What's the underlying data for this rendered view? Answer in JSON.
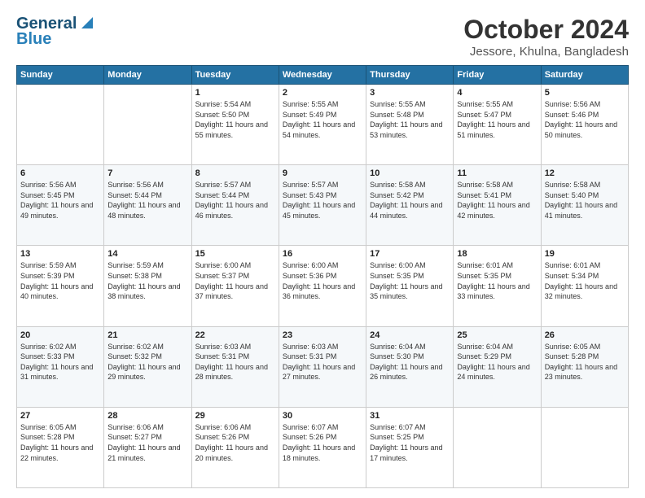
{
  "header": {
    "logo_line1": "General",
    "logo_line2": "Blue",
    "title": "October 2024",
    "subtitle": "Jessore, Khulna, Bangladesh"
  },
  "weekdays": [
    "Sunday",
    "Monday",
    "Tuesday",
    "Wednesday",
    "Thursday",
    "Friday",
    "Saturday"
  ],
  "weeks": [
    [
      {
        "day": "",
        "info": ""
      },
      {
        "day": "",
        "info": ""
      },
      {
        "day": "1",
        "info": "Sunrise: 5:54 AM\nSunset: 5:50 PM\nDaylight: 11 hours and 55 minutes."
      },
      {
        "day": "2",
        "info": "Sunrise: 5:55 AM\nSunset: 5:49 PM\nDaylight: 11 hours and 54 minutes."
      },
      {
        "day": "3",
        "info": "Sunrise: 5:55 AM\nSunset: 5:48 PM\nDaylight: 11 hours and 53 minutes."
      },
      {
        "day": "4",
        "info": "Sunrise: 5:55 AM\nSunset: 5:47 PM\nDaylight: 11 hours and 51 minutes."
      },
      {
        "day": "5",
        "info": "Sunrise: 5:56 AM\nSunset: 5:46 PM\nDaylight: 11 hours and 50 minutes."
      }
    ],
    [
      {
        "day": "6",
        "info": "Sunrise: 5:56 AM\nSunset: 5:45 PM\nDaylight: 11 hours and 49 minutes."
      },
      {
        "day": "7",
        "info": "Sunrise: 5:56 AM\nSunset: 5:44 PM\nDaylight: 11 hours and 48 minutes."
      },
      {
        "day": "8",
        "info": "Sunrise: 5:57 AM\nSunset: 5:44 PM\nDaylight: 11 hours and 46 minutes."
      },
      {
        "day": "9",
        "info": "Sunrise: 5:57 AM\nSunset: 5:43 PM\nDaylight: 11 hours and 45 minutes."
      },
      {
        "day": "10",
        "info": "Sunrise: 5:58 AM\nSunset: 5:42 PM\nDaylight: 11 hours and 44 minutes."
      },
      {
        "day": "11",
        "info": "Sunrise: 5:58 AM\nSunset: 5:41 PM\nDaylight: 11 hours and 42 minutes."
      },
      {
        "day": "12",
        "info": "Sunrise: 5:58 AM\nSunset: 5:40 PM\nDaylight: 11 hours and 41 minutes."
      }
    ],
    [
      {
        "day": "13",
        "info": "Sunrise: 5:59 AM\nSunset: 5:39 PM\nDaylight: 11 hours and 40 minutes."
      },
      {
        "day": "14",
        "info": "Sunrise: 5:59 AM\nSunset: 5:38 PM\nDaylight: 11 hours and 38 minutes."
      },
      {
        "day": "15",
        "info": "Sunrise: 6:00 AM\nSunset: 5:37 PM\nDaylight: 11 hours and 37 minutes."
      },
      {
        "day": "16",
        "info": "Sunrise: 6:00 AM\nSunset: 5:36 PM\nDaylight: 11 hours and 36 minutes."
      },
      {
        "day": "17",
        "info": "Sunrise: 6:00 AM\nSunset: 5:35 PM\nDaylight: 11 hours and 35 minutes."
      },
      {
        "day": "18",
        "info": "Sunrise: 6:01 AM\nSunset: 5:35 PM\nDaylight: 11 hours and 33 minutes."
      },
      {
        "day": "19",
        "info": "Sunrise: 6:01 AM\nSunset: 5:34 PM\nDaylight: 11 hours and 32 minutes."
      }
    ],
    [
      {
        "day": "20",
        "info": "Sunrise: 6:02 AM\nSunset: 5:33 PM\nDaylight: 11 hours and 31 minutes."
      },
      {
        "day": "21",
        "info": "Sunrise: 6:02 AM\nSunset: 5:32 PM\nDaylight: 11 hours and 29 minutes."
      },
      {
        "day": "22",
        "info": "Sunrise: 6:03 AM\nSunset: 5:31 PM\nDaylight: 11 hours and 28 minutes."
      },
      {
        "day": "23",
        "info": "Sunrise: 6:03 AM\nSunset: 5:31 PM\nDaylight: 11 hours and 27 minutes."
      },
      {
        "day": "24",
        "info": "Sunrise: 6:04 AM\nSunset: 5:30 PM\nDaylight: 11 hours and 26 minutes."
      },
      {
        "day": "25",
        "info": "Sunrise: 6:04 AM\nSunset: 5:29 PM\nDaylight: 11 hours and 24 minutes."
      },
      {
        "day": "26",
        "info": "Sunrise: 6:05 AM\nSunset: 5:28 PM\nDaylight: 11 hours and 23 minutes."
      }
    ],
    [
      {
        "day": "27",
        "info": "Sunrise: 6:05 AM\nSunset: 5:28 PM\nDaylight: 11 hours and 22 minutes."
      },
      {
        "day": "28",
        "info": "Sunrise: 6:06 AM\nSunset: 5:27 PM\nDaylight: 11 hours and 21 minutes."
      },
      {
        "day": "29",
        "info": "Sunrise: 6:06 AM\nSunset: 5:26 PM\nDaylight: 11 hours and 20 minutes."
      },
      {
        "day": "30",
        "info": "Sunrise: 6:07 AM\nSunset: 5:26 PM\nDaylight: 11 hours and 18 minutes."
      },
      {
        "day": "31",
        "info": "Sunrise: 6:07 AM\nSunset: 5:25 PM\nDaylight: 11 hours and 17 minutes."
      },
      {
        "day": "",
        "info": ""
      },
      {
        "day": "",
        "info": ""
      }
    ]
  ]
}
